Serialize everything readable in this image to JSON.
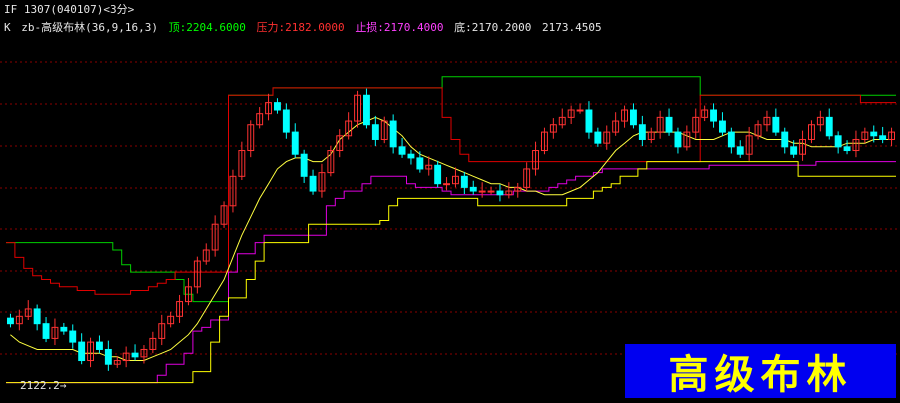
{
  "header": {
    "symbol": "IF",
    "contract": "1307(040107)",
    "period": "<3分>",
    "indicator_prefix": "K",
    "indicator_name": "zb-高级布林(36,9,16,3)",
    "top_label": "顶:2204.6000",
    "pressure_label": "压力:2182.0000",
    "stop_label": "止损:2170.4000",
    "bottom_label": "底:2170.2000",
    "extra_value": "2173.4505"
  },
  "low_marker": "2122.2",
  "watermark": "高级布林",
  "colors": {
    "background": "#000000",
    "up": "#ff3232",
    "down": "#00ffff",
    "top_line": "#00d000",
    "pressure_line": "#e00000",
    "stop_line": "#e000e0",
    "bottom_line": "#ffff00",
    "mid_line": "#ffff40",
    "grid": "#8a0000",
    "watermark_bg": "#0000f0",
    "watermark_text": "#ffff00"
  },
  "chart_data": {
    "type": "candlestick",
    "y_range": [
      2120,
      2215
    ],
    "series": [
      {
        "name": "顶",
        "values": [
          2160,
          2160,
          2160,
          2160,
          2160,
          2160,
          2160,
          2160,
          2160,
          2160,
          2160,
          2160,
          2158,
          2154,
          2152,
          2152,
          2152,
          2152,
          2152,
          2150,
          2146,
          2144,
          2144,
          2144,
          2144,
          2200,
          2200,
          2200,
          2200,
          2200,
          2202,
          2202,
          2202,
          2202,
          2202,
          2202,
          2202,
          2202,
          2202,
          2202,
          2202,
          2202,
          2202,
          2202,
          2202,
          2202,
          2202,
          2202,
          2202,
          2205,
          2205,
          2205,
          2205,
          2205,
          2205,
          2205,
          2205,
          2205,
          2205,
          2205,
          2205,
          2205,
          2205,
          2205,
          2205,
          2205,
          2205,
          2205,
          2205,
          2205,
          2205,
          2205,
          2205,
          2205,
          2205,
          2205,
          2205,
          2205,
          2200,
          2200,
          2200,
          2200,
          2200,
          2200,
          2200,
          2200,
          2200,
          2200,
          2200,
          2200,
          2200,
          2200,
          2200,
          2200,
          2200,
          2200,
          2200,
          2200,
          2200,
          2200
        ]
      },
      {
        "name": "压力",
        "values": [
          2160,
          2156,
          2153,
          2151,
          2150,
          2149,
          2148,
          2148,
          2147,
          2147,
          2146,
          2146,
          2146,
          2146,
          2147,
          2147,
          2148,
          2149,
          2150,
          2152,
          2152,
          2152,
          2152,
          2152,
          2152,
          2200,
          2200,
          2200,
          2200,
          2200,
          2202,
          2202,
          2202,
          2202,
          2202,
          2202,
          2202,
          2202,
          2202,
          2202,
          2202,
          2202,
          2202,
          2202,
          2202,
          2202,
          2202,
          2202,
          2202,
          2194,
          2188,
          2184,
          2182,
          2182,
          2182,
          2182,
          2182,
          2182,
          2182,
          2182,
          2182,
          2182,
          2182,
          2182,
          2182,
          2182,
          2182,
          2182,
          2182,
          2182,
          2182,
          2182,
          2182,
          2182,
          2182,
          2182,
          2182,
          2182,
          2200,
          2200,
          2200,
          2200,
          2200,
          2200,
          2200,
          2200,
          2200,
          2200,
          2200,
          2200,
          2200,
          2200,
          2200,
          2200,
          2200,
          2200,
          2198,
          2198,
          2198,
          2198
        ]
      },
      {
        "name": "止损",
        "values": [
          2122,
          2122,
          2122,
          2122,
          2122,
          2122,
          2122,
          2122,
          2122,
          2122,
          2122,
          2122,
          2122,
          2122,
          2122,
          2122,
          2122,
          2124,
          2127,
          2127,
          2130,
          2136,
          2137,
          2139,
          2139,
          2152,
          2157,
          2157,
          2160,
          2162,
          2162,
          2162,
          2162,
          2162,
          2162,
          2162,
          2170,
          2172,
          2174,
          2174,
          2176,
          2178,
          2178,
          2178,
          2178,
          2176,
          2175,
          2175,
          2175,
          2174,
          2173,
          2173,
          2173,
          2173,
          2173,
          2173,
          2173,
          2174,
          2174,
          2174,
          2174,
          2175,
          2176,
          2177,
          2178,
          2178,
          2179,
          2180,
          2180,
          2180,
          2180,
          2180,
          2180,
          2180,
          2180,
          2180,
          2180,
          2180,
          2180,
          2181,
          2181,
          2181,
          2181,
          2181,
          2181,
          2181,
          2181,
          2181,
          2181,
          2181,
          2181,
          2182,
          2182,
          2182,
          2182,
          2182,
          2182,
          2182,
          2182,
          2182
        ]
      },
      {
        "name": "底",
        "values": [
          2122,
          2122,
          2122,
          2122,
          2122,
          2122,
          2122,
          2122,
          2122,
          2122,
          2122,
          2122,
          2122,
          2122,
          2122,
          2122,
          2122,
          2122,
          2122,
          2122,
          2122,
          2125,
          2125,
          2133,
          2140,
          2145,
          2145,
          2150,
          2155,
          2160,
          2160,
          2160,
          2160,
          2160,
          2165,
          2165,
          2165,
          2165,
          2165,
          2165,
          2165,
          2165,
          2166,
          2170,
          2172,
          2172,
          2172,
          2172,
          2172,
          2172,
          2172,
          2172,
          2172,
          2170,
          2170,
          2170,
          2170,
          2170,
          2170,
          2170,
          2170,
          2170,
          2170,
          2172,
          2172,
          2172,
          2174,
          2175,
          2176,
          2178,
          2178,
          2180,
          2182,
          2182,
          2182,
          2182,
          2182,
          2182,
          2182,
          2182,
          2182,
          2182,
          2182,
          2182,
          2182,
          2182,
          2182,
          2182,
          2182,
          2178,
          2178,
          2178,
          2178,
          2178,
          2178,
          2178,
          2178,
          2178,
          2178,
          2178
        ]
      },
      {
        "name": "中轨",
        "values": [
          2135,
          2133,
          2132,
          2131,
          2131,
          2131,
          2131,
          2131,
          2130,
          2130,
          2130,
          2129,
          2129,
          2128,
          2128,
          2128,
          2129,
          2130,
          2131,
          2133,
          2135,
          2138,
          2142,
          2146,
          2150,
          2156,
          2162,
          2167,
          2172,
          2176,
          2180,
          2182,
          2183,
          2183,
          2182,
          2182,
          2184,
          2188,
          2190,
          2192,
          2193,
          2194,
          2193,
          2191,
          2189,
          2186,
          2184,
          2183,
          2182,
          2181,
          2180,
          2179,
          2178,
          2177,
          2176,
          2176,
          2175,
          2175,
          2174,
          2174,
          2173,
          2173,
          2173,
          2174,
          2175,
          2177,
          2179,
          2182,
          2185,
          2187,
          2189,
          2190,
          2190,
          2190,
          2190,
          2190,
          2189,
          2188,
          2188,
          2188,
          2189,
          2190,
          2190,
          2190,
          2189,
          2188,
          2188,
          2188,
          2187,
          2187,
          2186,
          2186,
          2186,
          2186,
          2187,
          2187,
          2187,
          2188,
          2188,
          2188
        ]
      },
      {
        "name": "K线",
        "values": [
          2138,
          2140,
          2142,
          2138,
          2134,
          2137,
          2136,
          2133,
          2128,
          2133,
          2131,
          2127,
          2128,
          2130,
          2129,
          2131,
          2134,
          2138,
          2140,
          2144,
          2148,
          2155,
          2158,
          2165,
          2170,
          2178,
          2185,
          2192,
          2195,
          2198,
          2196,
          2190,
          2184,
          2178,
          2174,
          2179,
          2185,
          2189,
          2193,
          2200,
          2192,
          2188,
          2193,
          2186,
          2184,
          2183,
          2180,
          2181,
          2176,
          2176,
          2178,
          2175,
          2174,
          2174,
          2174,
          2173,
          2174,
          2175,
          2180,
          2185,
          2190,
          2192,
          2194,
          2196,
          2196,
          2190,
          2187,
          2190,
          2193,
          2196,
          2192,
          2188,
          2190,
          2194,
          2190,
          2186,
          2190,
          2194,
          2196,
          2193,
          2190,
          2186,
          2184,
          2189,
          2192,
          2194,
          2190,
          2186,
          2184,
          2188,
          2192,
          2194,
          2189,
          2186,
          2185,
          2188,
          2190,
          2189,
          2188,
          2190
        ]
      }
    ]
  }
}
